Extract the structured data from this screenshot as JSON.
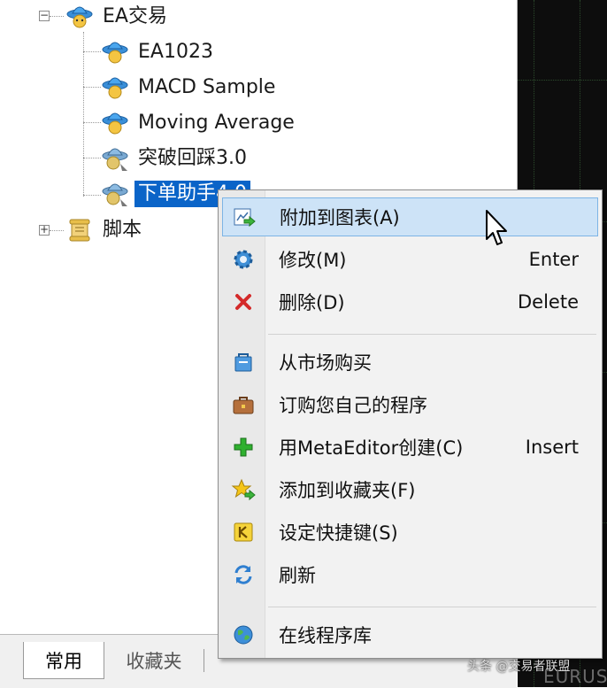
{
  "navigator": {
    "tree": {
      "ea_folder": {
        "label": "EA交易",
        "expander": "−"
      },
      "experts": [
        {
          "label": "EA1023"
        },
        {
          "label": "MACD Sample"
        },
        {
          "label": "Moving Average"
        },
        {
          "label": "突破回踩3.0"
        },
        {
          "label": "下单助手4.0"
        }
      ],
      "scripts_folder": {
        "label": "脚本",
        "expander": "+"
      }
    },
    "tabs": [
      {
        "label": "常用",
        "active": true
      },
      {
        "label": "收藏夹",
        "active": false
      }
    ]
  },
  "context_menu": {
    "items": [
      {
        "label": "附加到图表(A)",
        "shortcut": "",
        "icon": "attach-to-chart-icon"
      },
      {
        "label": "修改(M)",
        "shortcut": "Enter",
        "icon": "gear-icon"
      },
      {
        "label": "删除(D)",
        "shortcut": "Delete",
        "icon": "delete-x-icon"
      },
      {
        "label": "从市场购买",
        "shortcut": "",
        "icon": "market-bag-icon"
      },
      {
        "label": "订购您自己的程序",
        "shortcut": "",
        "icon": "briefcase-icon"
      },
      {
        "label": "用MetaEditor创建(C)",
        "shortcut": "Insert",
        "icon": "green-plus-icon"
      },
      {
        "label": "添加到收藏夹(F)",
        "shortcut": "",
        "icon": "star-icon"
      },
      {
        "label": "设定快捷键(S)",
        "shortcut": "",
        "icon": "hotkey-k-icon"
      },
      {
        "label": "刷新",
        "shortcut": "",
        "icon": "refresh-icon"
      },
      {
        "label": "在线程序库",
        "shortcut": "",
        "icon": "globe-icon"
      }
    ]
  },
  "chart": {
    "symbol": "EURUS"
  },
  "watermark": "头条 @交易者联盟",
  "colors": {
    "selection": "#0a64c8",
    "menu_highlight": "#cde3f7",
    "chart_background": "#0d0d0d"
  }
}
